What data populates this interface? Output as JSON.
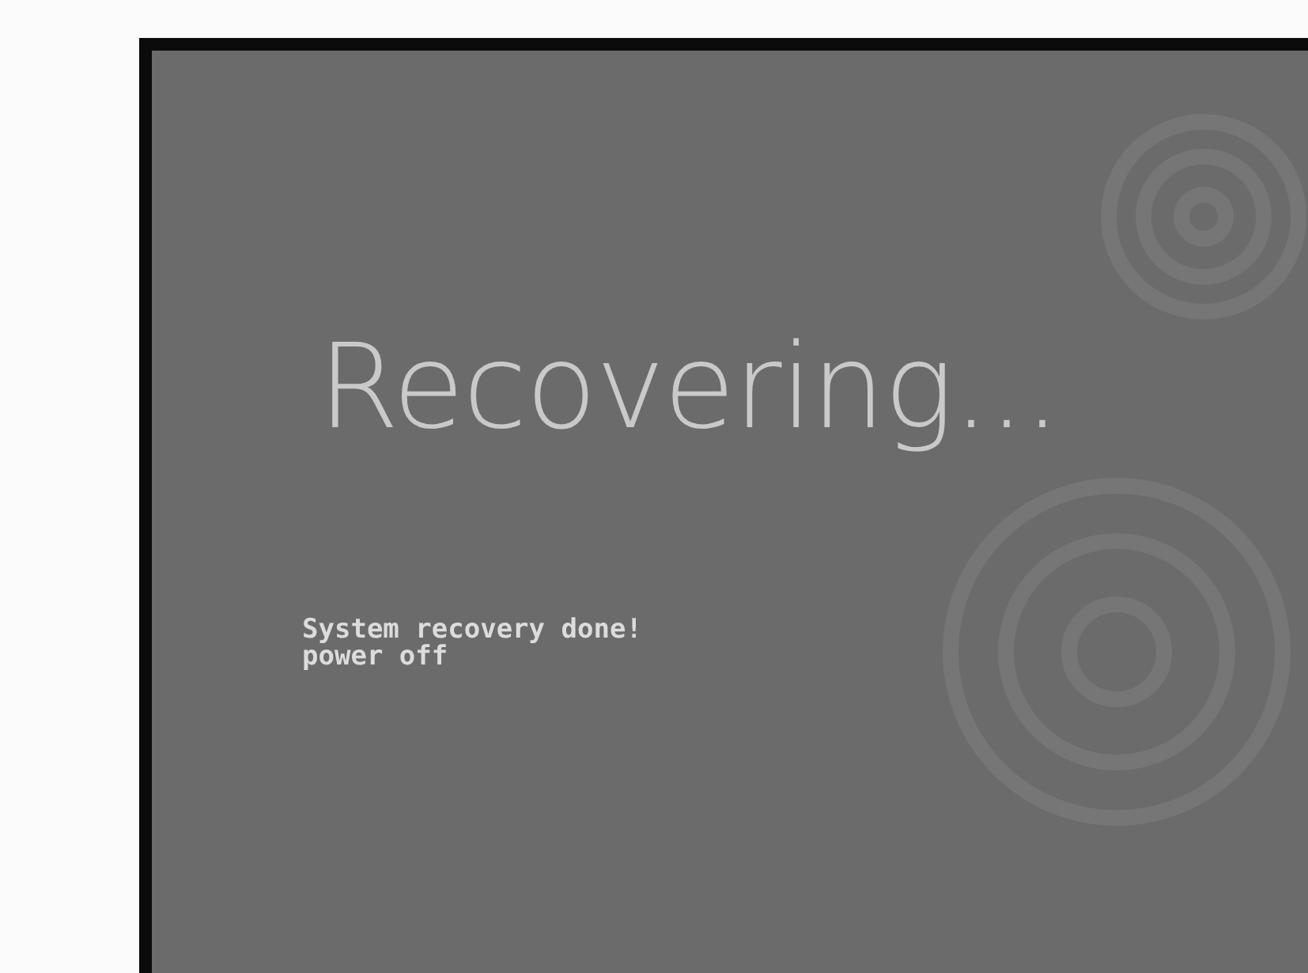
{
  "screen": {
    "title": "Recovering...",
    "message_lines": [
      "System recovery done!",
      "power off"
    ]
  }
}
